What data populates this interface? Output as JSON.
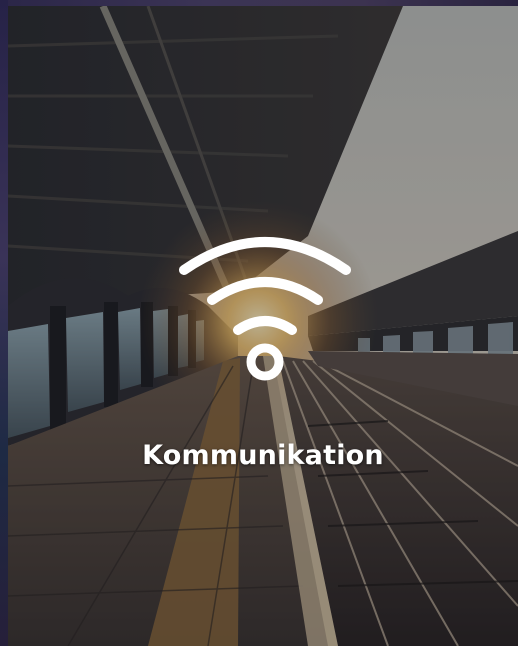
{
  "tile": {
    "label": "Kommunikation",
    "icon": "wifi-icon",
    "background": "train-platform-photo"
  },
  "colors": {
    "label_text": "#ffffff",
    "icon_stroke": "#ffffff",
    "sky": "#c9c7c0",
    "sun_glow": "#f6c46a"
  }
}
